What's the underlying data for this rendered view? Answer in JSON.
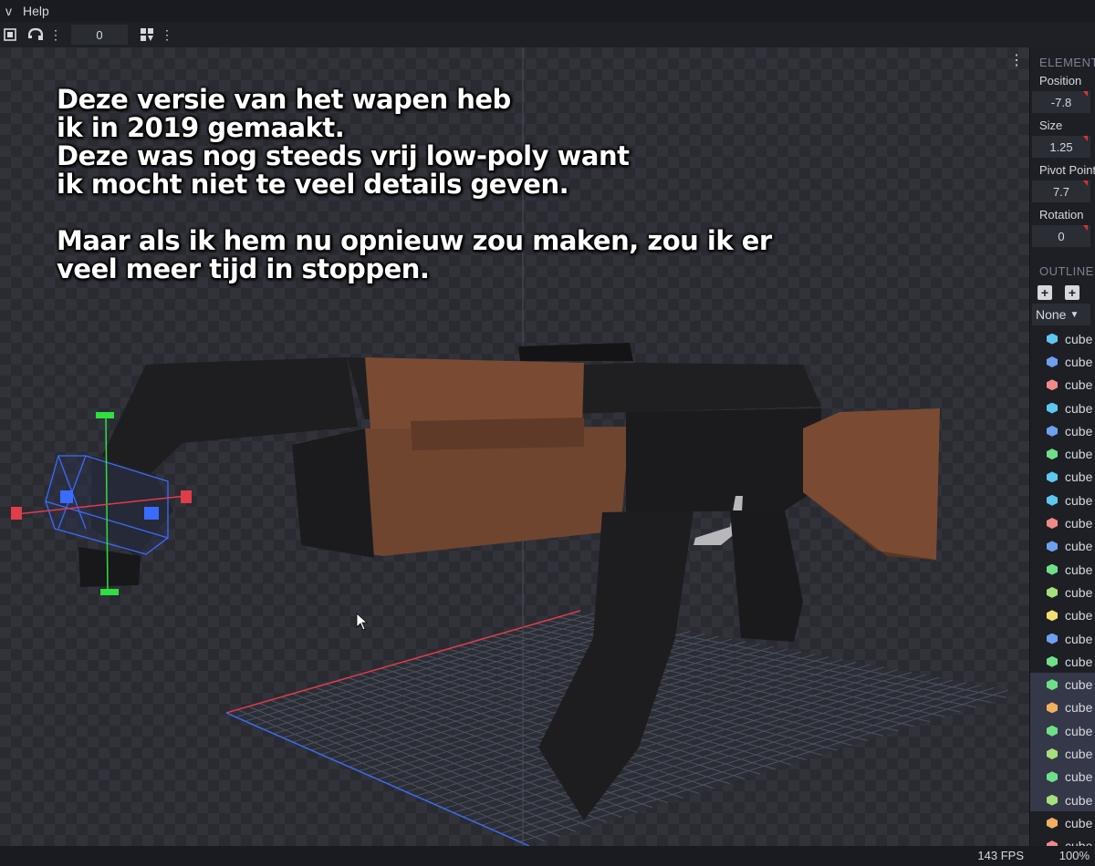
{
  "menubar": {
    "items": [
      "v",
      "Help"
    ]
  },
  "toolbar": {
    "frame_value": "0"
  },
  "caption": {
    "lines": [
      "Deze versie van het wapen heb",
      "ik in 2019 gemaakt.",
      "Deze was nog steeds vrij low-poly want",
      "ik mocht niet te veel details geven.",
      "",
      "Maar als ik hem nu opnieuw zou maken, zou ik er",
      "veel meer tijd in stoppen."
    ]
  },
  "element_panel": {
    "title": "ELEMENT",
    "position_label": "Position",
    "position_value": "-7.8",
    "size_label": "Size",
    "size_value": "1.25",
    "pivot_label": "Pivot Point",
    "pivot_value": "7.7",
    "rotation_label": "Rotation",
    "rotation_value": "0"
  },
  "outliner": {
    "title": "OUTLINER",
    "filter_value": "None",
    "items": [
      {
        "label": "cube",
        "color": "#5cc8f0",
        "selected": false
      },
      {
        "label": "cube",
        "color": "#6ea0f0",
        "selected": false
      },
      {
        "label": "cube",
        "color": "#f08a8a",
        "selected": false
      },
      {
        "label": "cube",
        "color": "#5cc8f0",
        "selected": false
      },
      {
        "label": "cube",
        "color": "#6ea0f0",
        "selected": false
      },
      {
        "label": "cube",
        "color": "#6ee08a",
        "selected": false
      },
      {
        "label": "cube",
        "color": "#5cc8f0",
        "selected": false
      },
      {
        "label": "cube",
        "color": "#5cc8f0",
        "selected": false
      },
      {
        "label": "cube",
        "color": "#f08a8a",
        "selected": false
      },
      {
        "label": "cube",
        "color": "#6ea0f0",
        "selected": false
      },
      {
        "label": "cube",
        "color": "#6ee08a",
        "selected": false
      },
      {
        "label": "cube",
        "color": "#a6e07a",
        "selected": false
      },
      {
        "label": "cube",
        "color": "#f0e070",
        "selected": false
      },
      {
        "label": "cube",
        "color": "#6ea0f0",
        "selected": false
      },
      {
        "label": "cube",
        "color": "#6ee08a",
        "selected": false
      },
      {
        "label": "cube",
        "color": "#6ee08a",
        "selected": true
      },
      {
        "label": "cube",
        "color": "#f0b060",
        "selected": true
      },
      {
        "label": "cube",
        "color": "#6ee08a",
        "selected": true
      },
      {
        "label": "cube",
        "color": "#a6e07a",
        "selected": true
      },
      {
        "label": "cube",
        "color": "#6ee08a",
        "selected": true
      },
      {
        "label": "cube",
        "color": "#a6e07a",
        "selected": true
      },
      {
        "label": "cube",
        "color": "#f0b060",
        "selected": false
      },
      {
        "label": "cube",
        "color": "#f08a8a",
        "selected": false
      }
    ]
  },
  "statusbar": {
    "fps": "143 FPS",
    "zoom": "100%"
  },
  "colors": {
    "wood": "#7a4b32",
    "metal": "#1d1d1f",
    "accent_select": "#3a6bff"
  }
}
